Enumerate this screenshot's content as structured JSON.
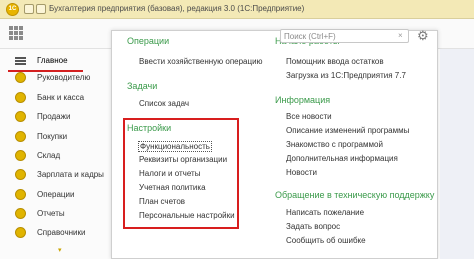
{
  "titlebar": {
    "title": "Бухгалтерия предприятия (базовая), редакция 3.0  (1С:Предприятие)",
    "logo_text": "1С"
  },
  "search": {
    "placeholder": "Поиск (Ctrl+F)",
    "clear_glyph": "×"
  },
  "sidebar": {
    "items": [
      {
        "label": "Главное"
      },
      {
        "label": "Руководителю"
      },
      {
        "label": "Банк и касса"
      },
      {
        "label": "Продажи"
      },
      {
        "label": "Покупки"
      },
      {
        "label": "Склад"
      },
      {
        "label": "Зарплата и кадры"
      },
      {
        "label": "Операции"
      },
      {
        "label": "Отчеты"
      },
      {
        "label": "Справочники"
      }
    ],
    "more_glyph": "▾"
  },
  "left": {
    "top_cut_heading": "Операции",
    "link_manual_op": "Ввести хозяйственную операцию",
    "tasks_heading": "Задачи",
    "link_tasks": "Список задач",
    "settings_heading": "Настройки",
    "settings_items": [
      "Функциональность",
      "Реквизиты организации",
      "Налоги и отчеты",
      "Учетная политика",
      "План счетов",
      "Персональные настройки"
    ]
  },
  "right": {
    "top_cut_heading": "Начало работы",
    "start_items": [
      "Помощник ввода остатков",
      "Загрузка из 1С:Предприятия 7.7"
    ],
    "info_heading": "Информация",
    "info_items": [
      "Все новости",
      "Описание изменений программы",
      "Знакомство с программой",
      "Дополнительная информация",
      "Новости"
    ],
    "support_heading": "Обращение в техническую поддержку",
    "support_items": [
      "Написать пожелание",
      "Задать вопрос",
      "Сообщить об ошибке"
    ]
  },
  "colors": {
    "accent_green": "#3a9a4a",
    "highlight_red": "#d81e1e",
    "titlebar_bg": "#f3e9b6",
    "icon_yellow": "#e0b400"
  }
}
